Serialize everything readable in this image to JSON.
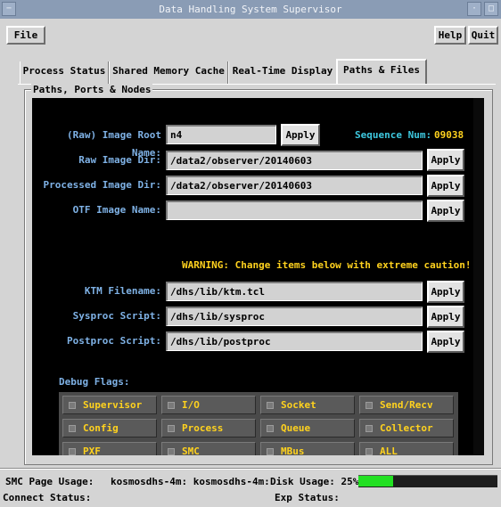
{
  "window": {
    "title": "Data Handling System Supervisor",
    "menu_icon": "minus",
    "minimize_icon": "dot",
    "maximize_icon": "square"
  },
  "menubar": {
    "file": "File",
    "help": "Help",
    "quit": "Quit"
  },
  "tabs": [
    {
      "label": "Process Status",
      "active": false
    },
    {
      "label": "Shared Memory Cache",
      "active": false
    },
    {
      "label": "Real-Time Display",
      "active": false
    },
    {
      "label": "Paths & Files",
      "active": true
    }
  ],
  "group_label": "Paths, Ports & Nodes",
  "fields": {
    "raw_root": {
      "label": "(Raw) Image Root Name:",
      "value": "n4"
    },
    "raw_dir": {
      "label": "Raw Image Dir:",
      "value": "/data2/observer/20140603"
    },
    "proc_dir": {
      "label": "Processed Image Dir:",
      "value": "/data2/observer/20140603"
    },
    "otf_name": {
      "label": "OTF Image Name:",
      "value": ""
    },
    "ktm_file": {
      "label": "KTM Filename:",
      "value": "/dhs/lib/ktm.tcl"
    },
    "sysproc": {
      "label": "Sysproc Script:",
      "value": "/dhs/lib/sysproc"
    },
    "postproc": {
      "label": "Postproc Script:",
      "value": "/dhs/lib/postproc"
    }
  },
  "apply_label": "Apply",
  "sequence": {
    "label": "Sequence Num:",
    "value": "09038"
  },
  "warning": "WARNING: Change items below with extreme caution!",
  "debug": {
    "title": "Debug Flags:",
    "flags": [
      "Supervisor",
      "I/O",
      "Socket",
      "Send/Recv",
      "Config",
      "Process",
      "Queue",
      "Collector",
      "PXF",
      "SMC",
      "MBus",
      "ALL"
    ]
  },
  "status": {
    "smc_label": "SMC Page Usage:",
    "smc_value": "kosmosdhs-4m: kosmosdhs-4m:",
    "disk_label": "Disk Usage: 25%",
    "disk_fraction": 0.25,
    "connect": "Connect Status:",
    "exp": "Exp Status:"
  },
  "colors": {
    "label_blue": "#7fb2e6",
    "warning_yellow": "#ffd21e",
    "disk_green": "#22e022",
    "panel_black": "#000000"
  }
}
